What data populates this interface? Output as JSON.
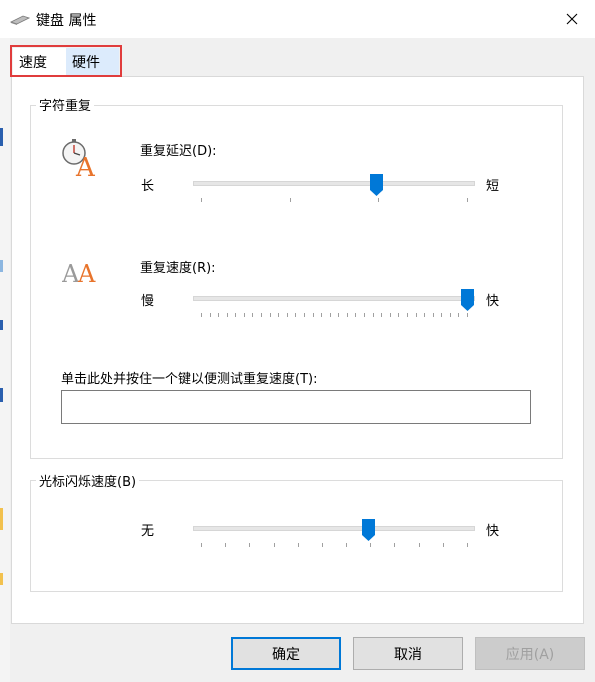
{
  "window": {
    "title": "键盘 属性"
  },
  "tabs": [
    {
      "label": "速度",
      "active": true
    },
    {
      "label": "硬件",
      "active": false
    }
  ],
  "char_repeat": {
    "group_label": "字符重复",
    "delay": {
      "label": "重复延迟(D):",
      "min_label": "长",
      "max_label": "短",
      "value_fraction": 0.66,
      "tick_count": 4
    },
    "rate": {
      "label": "重复速度(R):",
      "min_label": "慢",
      "max_label": "快",
      "value_fraction": 1.0,
      "tick_count": 32
    },
    "test_label": "单击此处并按住一个键以便测试重复速度(T):",
    "test_value": ""
  },
  "cursor_blink": {
    "group_label": "光标闪烁速度(B)",
    "min_label": "无",
    "max_label": "快",
    "value_fraction": 0.63,
    "tick_count": 12
  },
  "buttons": {
    "ok": "确定",
    "cancel": "取消",
    "apply": "应用(A)"
  },
  "colors": {
    "accent": "#0078d7",
    "highlight_border": "#e03c3c",
    "icon_orange": "#e8742c",
    "icon_gray": "#9a9a9a"
  }
}
